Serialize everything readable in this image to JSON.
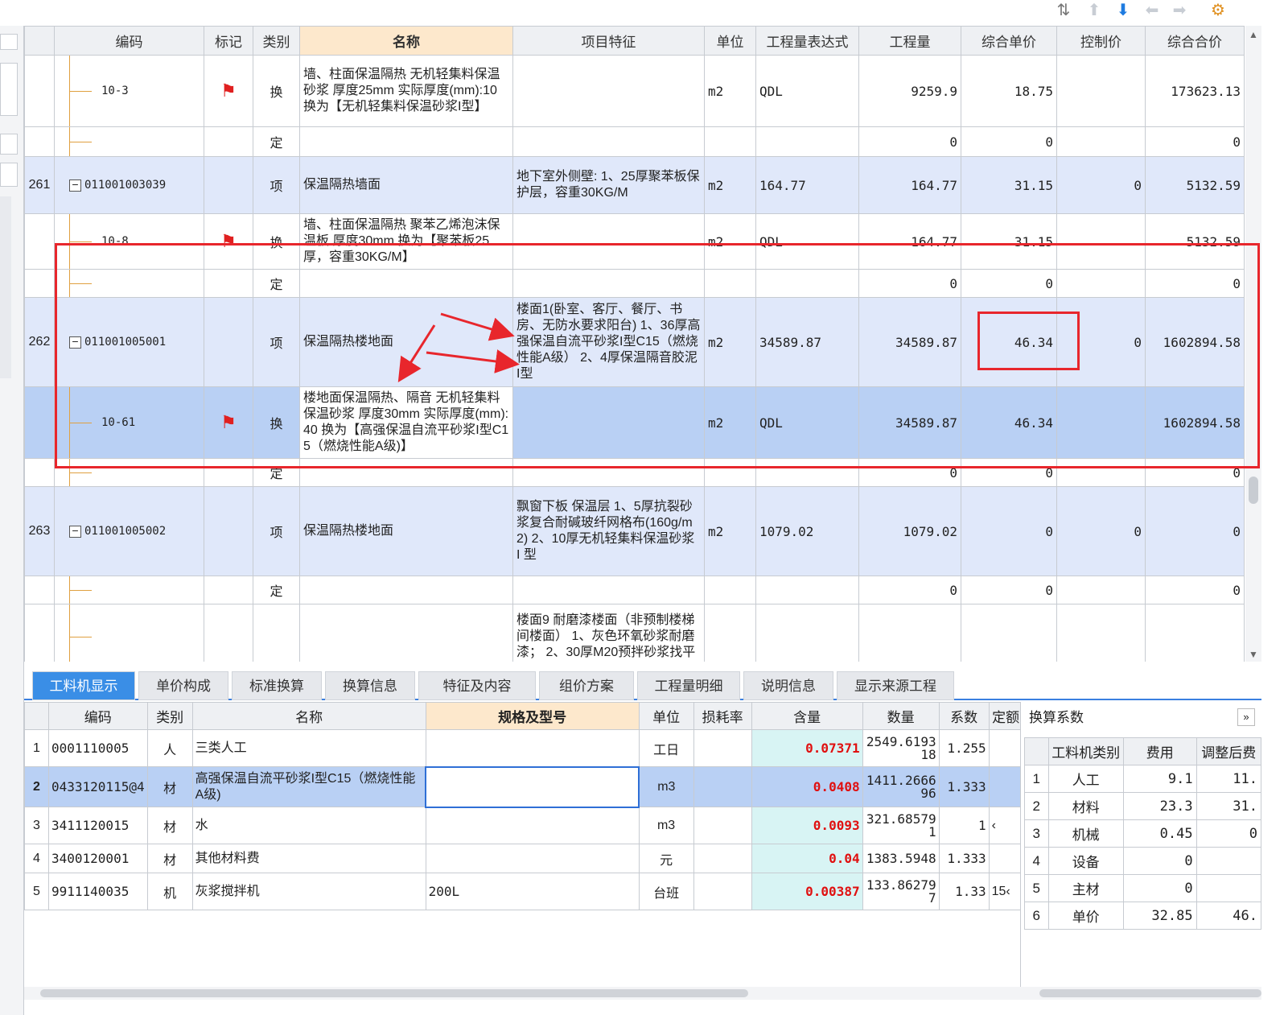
{
  "toolbar": {
    "icons": [
      "sort-icon",
      "move-up-icon",
      "move-down-icon",
      "move-left-icon",
      "move-right-icon",
      "settings-icon"
    ]
  },
  "grid": {
    "headers": {
      "code": "编码",
      "mark": "标记",
      "type": "类别",
      "name": "名称",
      "feature": "项目特征",
      "unit": "单位",
      "expr": "工程量表达式",
      "qty": "工程量",
      "price": "综合单价",
      "ctrl": "控制价",
      "total": "综合合价"
    },
    "rows": [
      {
        "no": "",
        "code": "10-3",
        "flag": true,
        "type": "换",
        "name": "墙、柱面保温隔热 无机轻集料保温砂浆 厚度25mm 实际厚度(mm):10 换为【无机轻集料保温砂浆I型】",
        "feature": "",
        "unit": "m2",
        "expr": "QDL",
        "qty": "9259.9",
        "price": "18.75",
        "ctrl": "",
        "total": "173623.13"
      },
      {
        "no": "",
        "code": "",
        "flag": false,
        "type": "定",
        "name": "",
        "feature": "",
        "unit": "",
        "expr": "",
        "qty": "0",
        "price": "0",
        "ctrl": "",
        "total": "0"
      },
      {
        "no": "261",
        "code": "011001003039",
        "flag": false,
        "type": "项",
        "name": "保温隔热墙面",
        "feature": "地下室外侧壁: 1、25厚聚苯板保护层，容重30KG/M",
        "unit": "m2",
        "expr": "164.77",
        "qty": "164.77",
        "price": "31.15",
        "ctrl": "0",
        "total": "5132.59"
      },
      {
        "no": "",
        "code": "10-8",
        "flag": true,
        "type": "换",
        "name": "墙、柱面保温隔热 聚苯乙烯泡沫保温板 厚度30mm 换为【聚苯板25厚，容重30KG/M】",
        "feature": "",
        "unit": "m2",
        "expr": "QDL",
        "qty": "164.77",
        "price": "31.15",
        "ctrl": "",
        "total": "5132.59"
      },
      {
        "no": "",
        "code": "",
        "flag": false,
        "type": "定",
        "name": "",
        "feature": "",
        "unit": "",
        "expr": "",
        "qty": "0",
        "price": "0",
        "ctrl": "",
        "total": "0"
      },
      {
        "no": "262",
        "code": "011001005001",
        "flag": false,
        "type": "项",
        "name": "保温隔热楼地面",
        "feature": "楼面1(卧室、客厅、餐厅、书房、无防水要求阳台) 1、36厚高强保温自流平砂浆I型C15（燃烧性能A级） 2、4厚保温隔音胶泥I型",
        "unit": "m2",
        "expr": "34589.87",
        "qty": "34589.87",
        "price": "46.34",
        "ctrl": "0",
        "total": "1602894.58"
      },
      {
        "no": "",
        "code": "10-61",
        "flag": true,
        "type": "换",
        "name": "楼地面保温隔热、隔音 无机轻集料保温砂浆 厚度30mm 实际厚度(mm):40 换为【高强保温自流平砂浆I型C15（燃烧性能A级)】",
        "feature": "",
        "unit": "m2",
        "expr": "QDL",
        "qty": "34589.87",
        "price": "46.34",
        "ctrl": "",
        "total": "1602894.58"
      },
      {
        "no": "",
        "code": "",
        "flag": false,
        "type": "定",
        "name": "",
        "feature": "",
        "unit": "",
        "expr": "",
        "qty": "0",
        "price": "0",
        "ctrl": "",
        "total": "0"
      },
      {
        "no": "263",
        "code": "011001005002",
        "flag": false,
        "type": "项",
        "name": "保温隔热楼地面",
        "feature": "飘窗下板 保温层 1、5厚抗裂砂浆复合耐碱玻纤网格布(160g/m2) 2、10厚无机轻集料保温砂浆 I 型",
        "unit": "m2",
        "expr": "1079.02",
        "qty": "1079.02",
        "price": "0",
        "ctrl": "0",
        "total": "0"
      },
      {
        "no": "",
        "code": "",
        "flag": false,
        "type": "定",
        "name": "",
        "feature": "",
        "unit": "",
        "expr": "",
        "qty": "0",
        "price": "0",
        "ctrl": "",
        "total": "0"
      },
      {
        "no": "",
        "code": "",
        "flag": false,
        "type": "",
        "name": "",
        "feature": "楼面9 耐磨漆楼面（非预制楼梯间楼面） 1、灰色环氧砂浆耐磨漆； 2、30厚M20预拌砂浆找平",
        "unit": "",
        "expr": "",
        "qty": "",
        "price": "",
        "ctrl": "",
        "total": ""
      }
    ]
  },
  "bottom_tabs": [
    "工料机显示",
    "单价构成",
    "标准换算",
    "换算信息",
    "特征及内容",
    "组价方案",
    "工程量明细",
    "说明信息",
    "显示来源工程"
  ],
  "resources": {
    "headers": {
      "no": "",
      "code": "编码",
      "type": "类别",
      "name": "名称",
      "spec": "规格及型号",
      "unit": "单位",
      "loss": "损耗率",
      "content": "含量",
      "amount": "数量",
      "coef": "系数",
      "quota": "定额"
    },
    "rows": [
      {
        "no": "1",
        "code": "0001110005",
        "type": "人",
        "name": "三类人工",
        "spec": "",
        "unit": "工日",
        "loss": "",
        "content": "0.07371",
        "amount": "2549.619318",
        "coef": "1.255",
        "quota": ""
      },
      {
        "no": "2",
        "code": "0433120115@4",
        "type": "材",
        "name": "高强保温自流平砂浆I型C15（燃烧性能A级)",
        "spec": "",
        "unit": "m3",
        "loss": "",
        "content": "0.0408",
        "amount": "1411.266696",
        "coef": "1.333",
        "quota": ""
      },
      {
        "no": "3",
        "code": "3411120015",
        "type": "材",
        "name": "水",
        "spec": "",
        "unit": "m3",
        "loss": "",
        "content": "0.0093",
        "amount": "321.685791",
        "coef": "1",
        "quota": "‹"
      },
      {
        "no": "4",
        "code": "3400120001",
        "type": "材",
        "name": "其他材料费",
        "spec": "",
        "unit": "元",
        "loss": "",
        "content": "0.04",
        "amount": "1383.5948",
        "coef": "1.333",
        "quota": ""
      },
      {
        "no": "5",
        "code": "9911140035",
        "type": "机",
        "name": "灰浆搅拌机",
        "spec": "200L",
        "unit": "台班",
        "loss": "",
        "content": "0.00387",
        "amount": "133.862797",
        "coef": "1.33",
        "quota": "15‹"
      }
    ]
  },
  "coef_panel": {
    "title": "换算系数",
    "headers": {
      "no": "",
      "cat": "工料机类别",
      "fee": "费用",
      "adj": "调整后费"
    },
    "rows": [
      {
        "no": "1",
        "cat": "人工",
        "fee": "9.1",
        "adj": "11."
      },
      {
        "no": "2",
        "cat": "材料",
        "fee": "23.3",
        "adj": "31."
      },
      {
        "no": "3",
        "cat": "机械",
        "fee": "0.45",
        "adj": "0"
      },
      {
        "no": "4",
        "cat": "设备",
        "fee": "0",
        "adj": ""
      },
      {
        "no": "5",
        "cat": "主材",
        "fee": "0",
        "adj": ""
      },
      {
        "no": "6",
        "cat": "单价",
        "fee": "32.85",
        "adj": "46."
      }
    ]
  },
  "colors": {
    "annotation": "#e8262c",
    "selected_row": "#b9d0f4",
    "item_row": "#e0e8fa",
    "accent": "#3a8ee6"
  }
}
